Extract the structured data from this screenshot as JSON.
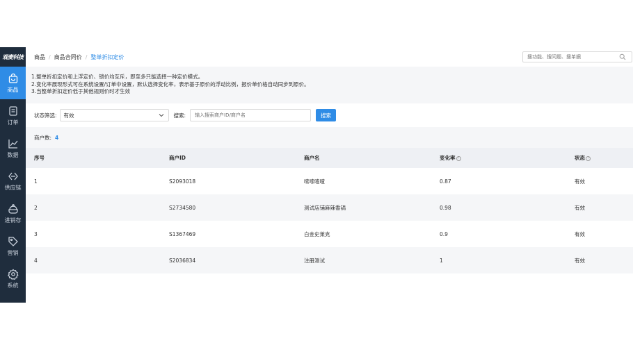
{
  "sidebar": {
    "logo": "观麦科技",
    "items": [
      {
        "label": "商品",
        "icon": "bag-icon",
        "active": true
      },
      {
        "label": "订单",
        "icon": "order-icon",
        "active": false
      },
      {
        "label": "数据",
        "icon": "chart-icon",
        "active": false
      },
      {
        "label": "供应链",
        "icon": "supply-chain-icon",
        "active": false
      },
      {
        "label": "进销存",
        "icon": "inventory-icon",
        "active": false
      },
      {
        "label": "营销",
        "icon": "tag-icon",
        "active": false
      },
      {
        "label": "系统",
        "icon": "settings-icon",
        "active": false
      }
    ]
  },
  "breadcrumb": [
    "商品",
    "商品合同价",
    "整单折扣定价"
  ],
  "top_search": {
    "placeholder": "搜功能、搜问题、搜单据"
  },
  "notice": {
    "line1": "1.整单折扣定价和上浮定价、锁价均互斥，即至多只能选择一种定价模式。",
    "line2": "2.变化率展现形式可在系统设置/订单中设置，默认选择变化率，表示基于原价的浮动比例，报价单价格自动同步到原价。",
    "line3": "3.当整单折扣定价低于其他规则价时才生效"
  },
  "filter": {
    "status_label": "状态筛选:",
    "status_value": "有效",
    "search_label": "搜索:",
    "search_placeholder": "输入搜索商户ID/商户名",
    "search_button": "搜索"
  },
  "count": {
    "label": "商户数:",
    "value": "4"
  },
  "table": {
    "columns": [
      "序号",
      "商户ID",
      "商户名",
      "变化率",
      "状态"
    ],
    "rows": [
      {
        "index": "1",
        "merchant_id": "S2093018",
        "merchant_name": "嗦嗦喳喳",
        "rate": "0.87",
        "status": "有效"
      },
      {
        "index": "2",
        "merchant_id": "S2734580",
        "merchant_name": "测试店铺麻辣香锅",
        "rate": "0.98",
        "status": "有效"
      },
      {
        "index": "3",
        "merchant_id": "S1367469",
        "merchant_name": "白金史莱克",
        "rate": "0.9",
        "status": "有效"
      },
      {
        "index": "4",
        "merchant_id": "S2036834",
        "merchant_name": "注册测试",
        "rate": "1",
        "status": "有效"
      }
    ]
  },
  "colors": {
    "accent": "#2f8ce6",
    "sidebar_bg": "#1f2d3d"
  }
}
